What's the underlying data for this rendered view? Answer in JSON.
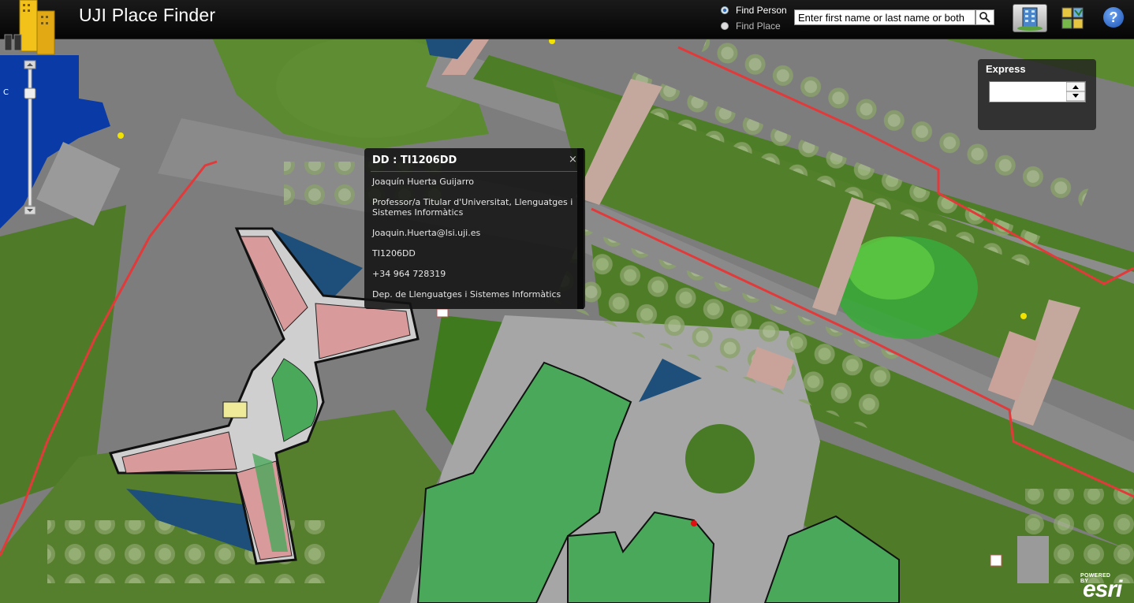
{
  "header": {
    "app_title": "UJI Place Finder",
    "find_person_label": "Find Person",
    "find_place_label": "Find Place",
    "search_placeholder": "Enter first name or last name or both",
    "selected_mode": "Find Person"
  },
  "express": {
    "label": "Express"
  },
  "popup": {
    "title": "DD : TI1206DD",
    "close": "×",
    "name": "Joaquín Huerta Guijarro",
    "position": "Professor/a Titular d'Universitat, Llenguatges i Sistemes Informàtics",
    "email": "Joaquin.Huerta@lsi.uji.es",
    "office": "TI1206DD",
    "phone": "+34 964 728319",
    "department": "Dep. de Llenguatges i Sistemes Informàtics"
  },
  "map_label": "C",
  "esri": {
    "powered_by": "POWERED BY",
    "brand": "esri"
  },
  "icons": {
    "binoculars": "binoculars-icon",
    "search": "search-icon",
    "building": "building-icon",
    "layers": "layers-icon",
    "help": "help-icon"
  },
  "colors": {
    "header_bg": "#0b0b0b",
    "grass": "#4f7a2a",
    "building_green": "#4aa85a",
    "water": "#1e4f7a",
    "blue_building": "#0a3aa6",
    "room_pink": "#d89a9a",
    "red_path": "#e23a3a",
    "help_blue": "#1a53b5"
  }
}
